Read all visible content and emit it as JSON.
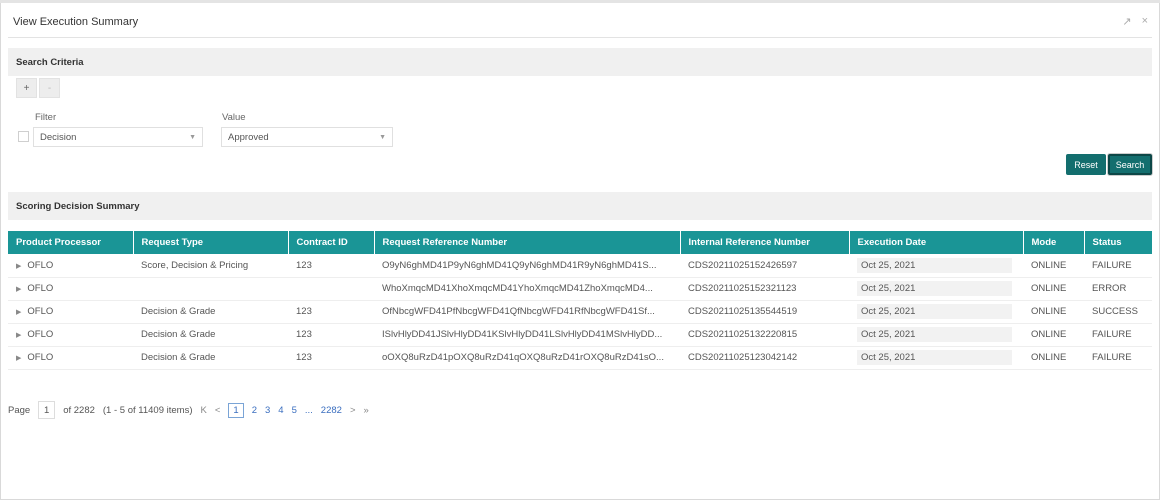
{
  "window": {
    "title": "View Execution Summary",
    "controls": [
      "↗",
      "×"
    ]
  },
  "search_criteria": {
    "heading": "Search Criteria",
    "add_label": "+",
    "remove_label": "-",
    "filter_label": "Filter",
    "value_label": "Value",
    "filter_selected": "Decision",
    "value_selected": "Approved",
    "reset_label": "Reset",
    "search_label": "Search"
  },
  "summary": {
    "heading": "Scoring Decision Summary",
    "columns": [
      "Product Processor",
      "Request Type",
      "Contract ID",
      "Request Reference Number",
      "Internal Reference Number",
      "Execution Date",
      "Mode",
      "Status"
    ],
    "rows": [
      {
        "processor": "OFLO",
        "request_type": "Score, Decision & Pricing",
        "contract_id": "123",
        "request_ref": "O9yN6ghMD41P9yN6ghMD41Q9yN6ghMD41R9yN6ghMD41S...",
        "internal_ref": "CDS20211025152426597",
        "date": "Oct 25, 2021",
        "mode": "ONLINE",
        "status": "FAILURE"
      },
      {
        "processor": "OFLO",
        "request_type": "",
        "contract_id": "",
        "request_ref": "WhoXmqcMD41XhoXmqcMD41YhoXmqcMD41ZhoXmqcMD4...",
        "internal_ref": "CDS20211025152321123",
        "date": "Oct 25, 2021",
        "mode": "ONLINE",
        "status": "ERROR"
      },
      {
        "processor": "OFLO",
        "request_type": "Decision & Grade",
        "contract_id": "123",
        "request_ref": "OfNbcgWFD41PfNbcgWFD41QfNbcgWFD41RfNbcgWFD41Sf...",
        "internal_ref": "CDS20211025135544519",
        "date": "Oct 25, 2021",
        "mode": "ONLINE",
        "status": "SUCCESS"
      },
      {
        "processor": "OFLO",
        "request_type": "Decision & Grade",
        "contract_id": "123",
        "request_ref": "ISlvHlyDD41JSlvHlyDD41KSlvHlyDD41LSlvHlyDD41MSlvHlyDD...",
        "internal_ref": "CDS20211025132220815",
        "date": "Oct 25, 2021",
        "mode": "ONLINE",
        "status": "FAILURE"
      },
      {
        "processor": "OFLO",
        "request_type": "Decision & Grade",
        "contract_id": "123",
        "request_ref": "oOXQ8uRzD41pOXQ8uRzD41qOXQ8uRzD41rOXQ8uRzD41sO...",
        "internal_ref": "CDS20211025123042142",
        "date": "Oct 25, 2021",
        "mode": "ONLINE",
        "status": "FAILURE"
      }
    ]
  },
  "pagination": {
    "page_label": "Page",
    "current_page": "1",
    "of_pages": "of 2282",
    "items_info": "(1 - 5 of 11409 items)",
    "first": "K",
    "prev": "<",
    "pages": [
      "1",
      "2",
      "3",
      "4",
      "5"
    ],
    "ellipsis": "...",
    "last_page": "2282",
    "next": ">",
    "last": "»"
  }
}
